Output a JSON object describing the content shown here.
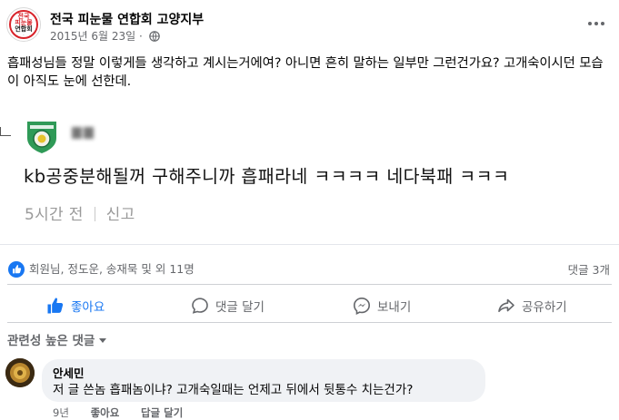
{
  "post": {
    "page_name": "전국 피눈물 연합회 고양지부",
    "date": "2015년 6월 23일 ·",
    "avatar_lines": [
      "전국",
      "피눈물",
      "연합회",
      "·"
    ],
    "text": "흡패성님들 정말 이렇게들 생각하고 계시는거에여? 아니면 흔히 말하는 일부만 그런건가요? 고개숙이시던 모습이 아직도 눈에 선한데."
  },
  "embedded_comment": {
    "text": "kb공중분해될꺼 구해주니까 흡패라네 ㅋㅋㅋㅋ 네다북패 ㅋㅋㅋ",
    "time": "5시간 전",
    "report_label": "신고"
  },
  "stats": {
    "reactions": "회원님, 정도운, 송재묵 및 외 11명",
    "comments": "댓글 3개"
  },
  "actions": {
    "like": "좋아요",
    "comment": "댓글 달기",
    "send": "보내기",
    "share": "공유하기"
  },
  "comments_section": {
    "sort_label": "관련성 높은 댓글",
    "comments": [
      {
        "author": "안세민",
        "text": "저 글 쓴놈 흡패놈이냐? 고개숙일때는 언제고 뒤에서 뒷통수 치는건가?",
        "age": "9년",
        "like_label": "좋아요",
        "reply_label": "답글 달기"
      }
    ]
  },
  "colors": {
    "accent": "#1877f2",
    "secondary_text": "#65676b",
    "bubble": "#f0f2f5",
    "brand_red": "#d8232a"
  }
}
